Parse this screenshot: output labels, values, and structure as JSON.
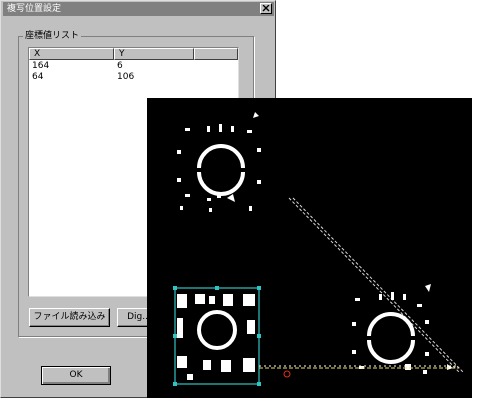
{
  "dialog": {
    "title": "複写位置設定",
    "group_label": "座標値リスト",
    "list": {
      "columns": [
        "X",
        "Y"
      ],
      "rows": [
        {
          "x": "164",
          "y": "6"
        },
        {
          "x": "64",
          "y": "106"
        }
      ]
    },
    "buttons": {
      "load_file": "ファイル読み込み",
      "dig": "Dig...",
      "ok": "OK"
    }
  },
  "colors": {
    "dialog_bg": "#c0c0c0",
    "titlebar_inactive": "#808080",
    "viewer_bg": "#000000",
    "highlight_outline": "#2ec4c4",
    "marker_red": "#e03020",
    "guide_line": "#f0e060"
  },
  "icons": {
    "close": "close-x-icon"
  }
}
